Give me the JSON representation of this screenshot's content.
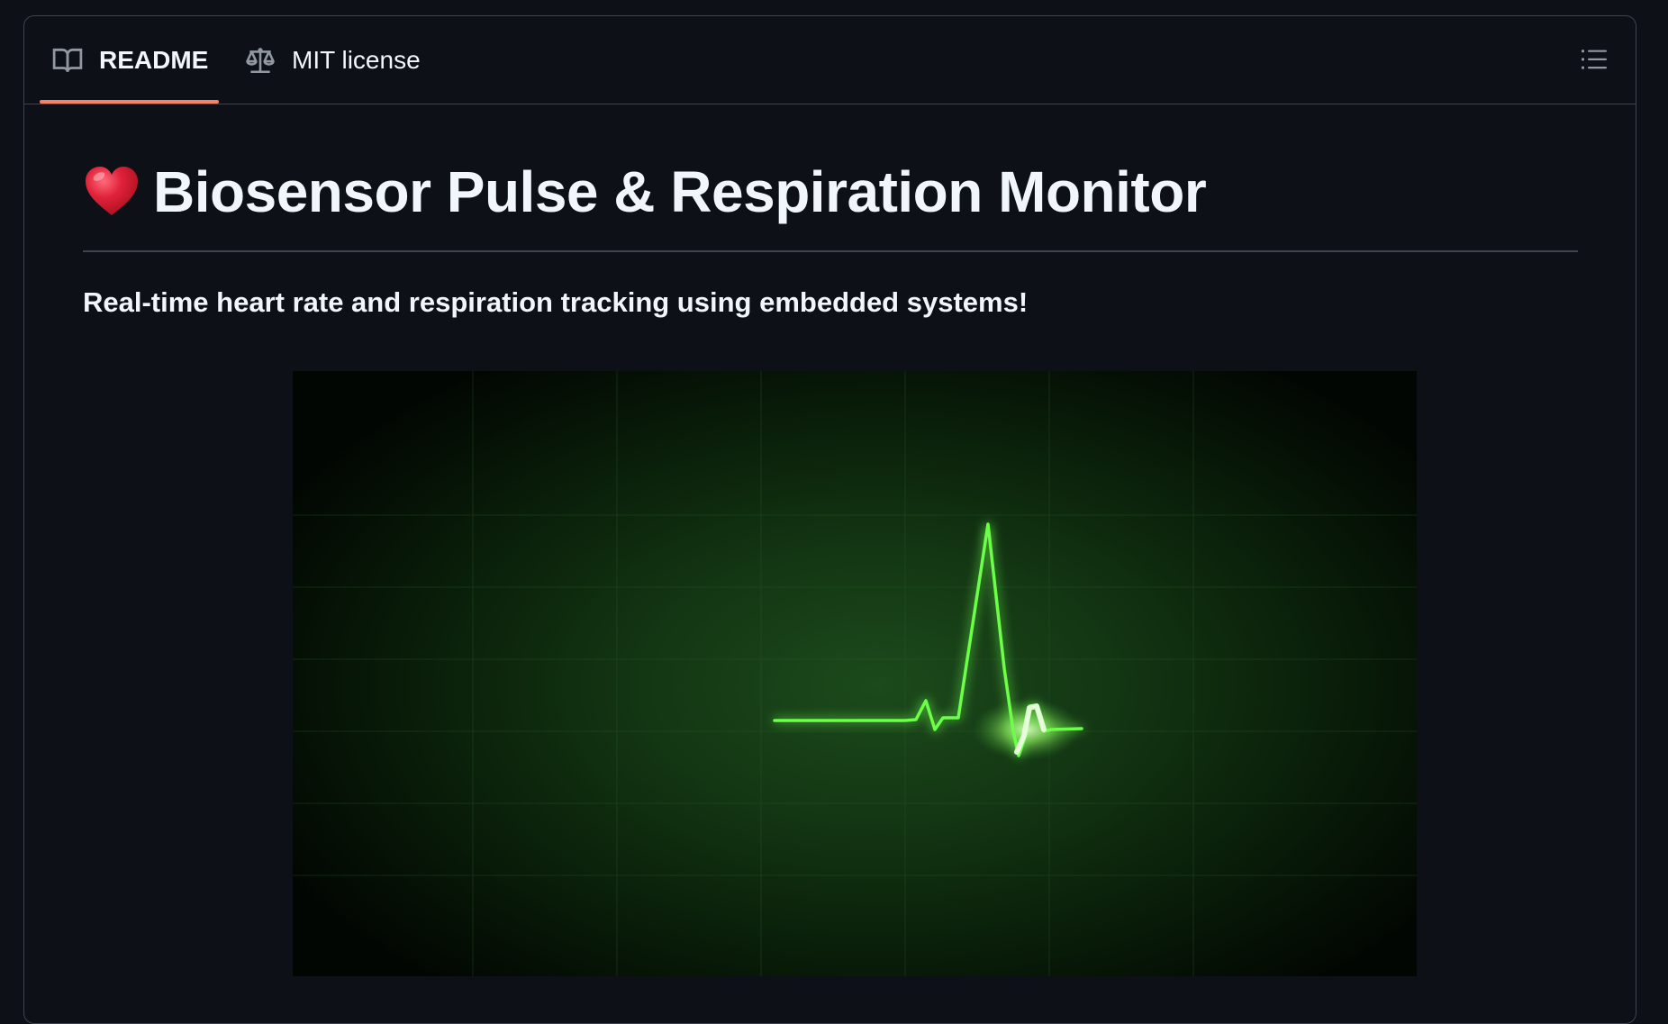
{
  "tabs": [
    {
      "label": "README",
      "icon": "book-icon",
      "active": true
    },
    {
      "label": "MIT license",
      "icon": "law-icon",
      "active": false
    }
  ],
  "toolbar": {
    "outline_icon": "list-unordered-icon"
  },
  "readme": {
    "title": "Biosensor Pulse & Respiration Monitor",
    "title_icon": "heart-emoji-icon",
    "subtitle": "Real-time heart rate and respiration tracking using embedded systems!",
    "image_icon": "heartbeat-monitor-image"
  },
  "colors": {
    "background": "#0d1117",
    "border": "#3d444d",
    "active_tab_underline": "#f78166",
    "text": "#f0f6fc",
    "ecg_trace": "#6cff4a",
    "heart": "#e0223a"
  }
}
